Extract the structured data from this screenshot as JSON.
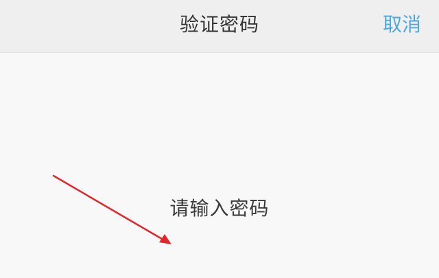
{
  "header": {
    "title": "验证密码",
    "cancel_label": "取消"
  },
  "main": {
    "prompt": "请输入密码"
  },
  "colors": {
    "accent": "#4aa7e3",
    "annotation_arrow": "#e0262a"
  },
  "icons": {
    "annotation": "red-arrow-icon"
  }
}
